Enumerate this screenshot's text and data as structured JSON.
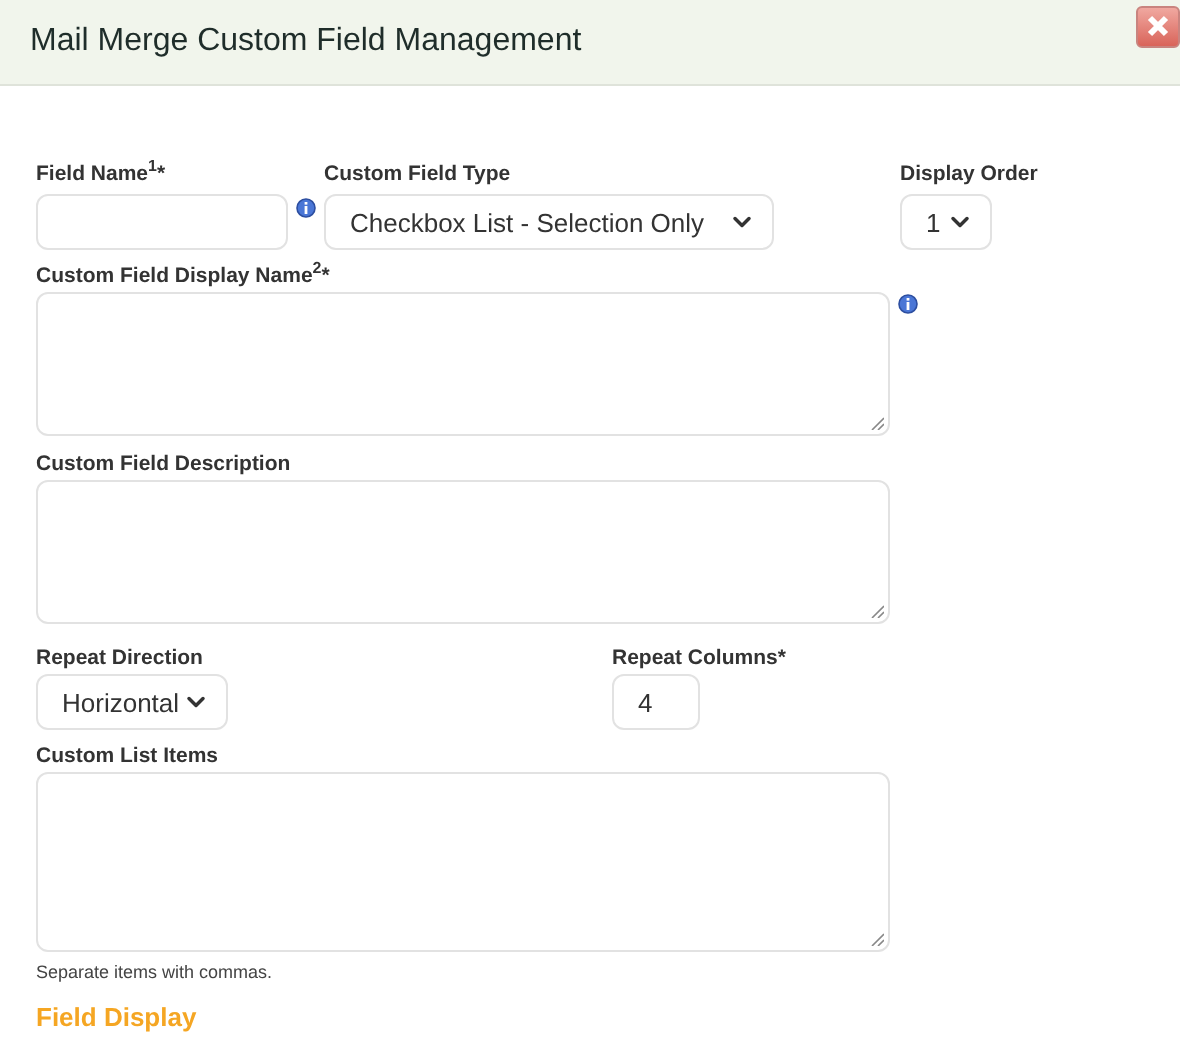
{
  "dialog": {
    "title": "Mail Merge Custom Field Management"
  },
  "row_1": [
    {
      "kind": "text",
      "label": "Field Name$^{1}$*",
      "info": true
    },
    {
      "kind": "select",
      "label": "Custom Field Type",
      "value": "Checkbox List - Selection Only"
    },
    {
      "kind": "select",
      "label": "Display Order",
      "value": "1"
    }
  ],
  "display_name": {
    "label": "Custom Field Display Name$^{2}$*",
    "info": true
  },
  "description": {
    "label": "Custom Field Description"
  },
  "row_4": [
    {
      "kind": "select",
      "label": "Repeat Direction",
      "value": "Horizontal"
    },
    {
      "kind": "text",
      "label": "Repeat Columns*",
      "value": "4"
    }
  ],
  "list_items": {
    "label": "Custom List Items",
    "hint": "Separate items with commas."
  },
  "section": {
    "title": "Field Display"
  }
}
